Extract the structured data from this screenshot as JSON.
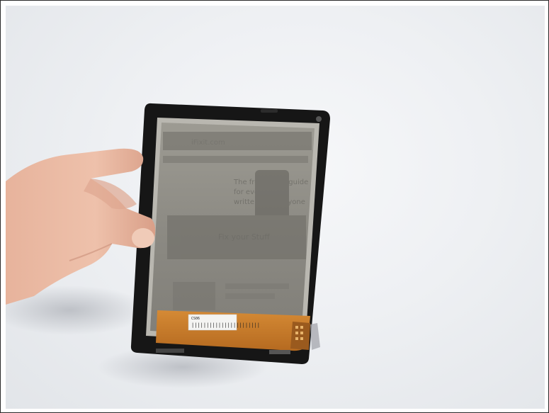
{
  "image": {
    "subject": "e-reader display panel held in hand",
    "colors": {
      "background": "#eef0f3",
      "bezel": "#161616",
      "screen": "#8d8b84",
      "flex_cable": "#c77a2a",
      "skin": "#e9b9a3"
    }
  },
  "screen": {
    "headline_line1": "The free repair guide",
    "headline_line2": "for everything,",
    "headline_line3": "written by everyone",
    "nav_text": "iFixit.com",
    "section_text": "Fix your Stuff"
  },
  "flex_label": {
    "line1": "CS06",
    "line2": "|||||||||||||||||||||||"
  }
}
